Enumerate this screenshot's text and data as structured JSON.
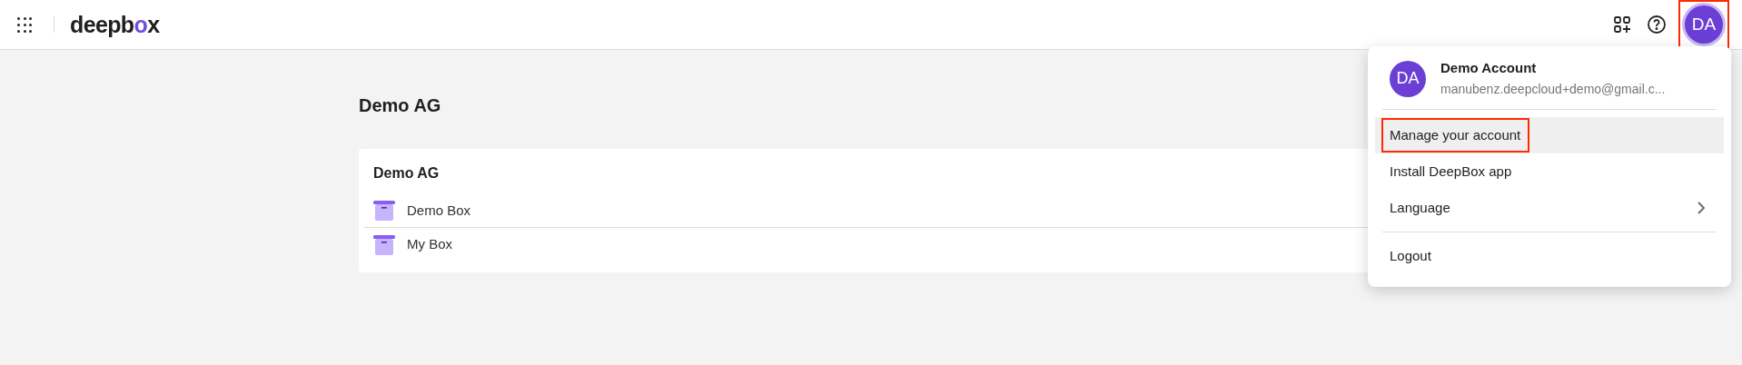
{
  "header": {
    "logo_parts": [
      "deepb",
      "o",
      "x"
    ],
    "avatar": {
      "initials": "DA",
      "highlighted": true
    }
  },
  "page": {
    "title": "Demo AG",
    "card": {
      "title": "Demo AG",
      "boxes": [
        {
          "name": "Demo Box"
        },
        {
          "name": "My Box"
        }
      ]
    }
  },
  "account_menu": {
    "initials": "DA",
    "name": "Demo Account",
    "email": "manubenz.deepcloud+demo@gmail.c...",
    "groups": [
      [
        {
          "kind": "action",
          "label": "Manage your account",
          "hovered": true,
          "highlighted": true
        },
        {
          "kind": "action",
          "label": "Install DeepBox app",
          "hovered": false,
          "highlighted": false
        },
        {
          "kind": "submenu",
          "label": "Language",
          "hovered": false,
          "highlighted": false
        }
      ],
      [
        {
          "kind": "action",
          "label": "Logout",
          "hovered": false,
          "highlighted": false
        }
      ]
    ]
  }
}
